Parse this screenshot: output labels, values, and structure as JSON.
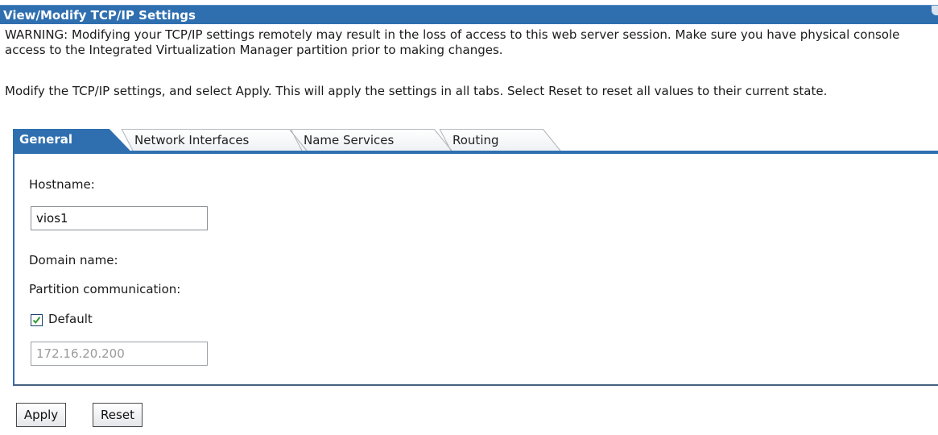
{
  "window": {
    "title": "View/Modify TCP/IP Settings"
  },
  "messages": {
    "warning": "WARNING: Modifying your TCP/IP settings remotely may result in the loss of access to this web server session. Make sure you have physical console access to the Integrated Virtualization Manager partition prior to making changes.",
    "instructions": "Modify the TCP/IP settings, and select Apply. This will apply the settings in all tabs. Select Reset to reset all values to their current state."
  },
  "tabs": [
    {
      "label": "General",
      "active": true
    },
    {
      "label": "Network Interfaces",
      "active": false
    },
    {
      "label": "Name Services",
      "active": false
    },
    {
      "label": "Routing",
      "active": false
    }
  ],
  "general": {
    "hostname_label": "Hostname:",
    "hostname_value": "vios1",
    "domain_label": "Domain name:",
    "partition_label": "Partition communication:",
    "default_label": "Default",
    "default_checked": true,
    "partition_ip": "172.16.20.200"
  },
  "buttons": {
    "apply": "Apply",
    "reset": "Reset"
  },
  "colors": {
    "accent": "#2f6fb0",
    "checkmark": "#2e9a2e"
  }
}
